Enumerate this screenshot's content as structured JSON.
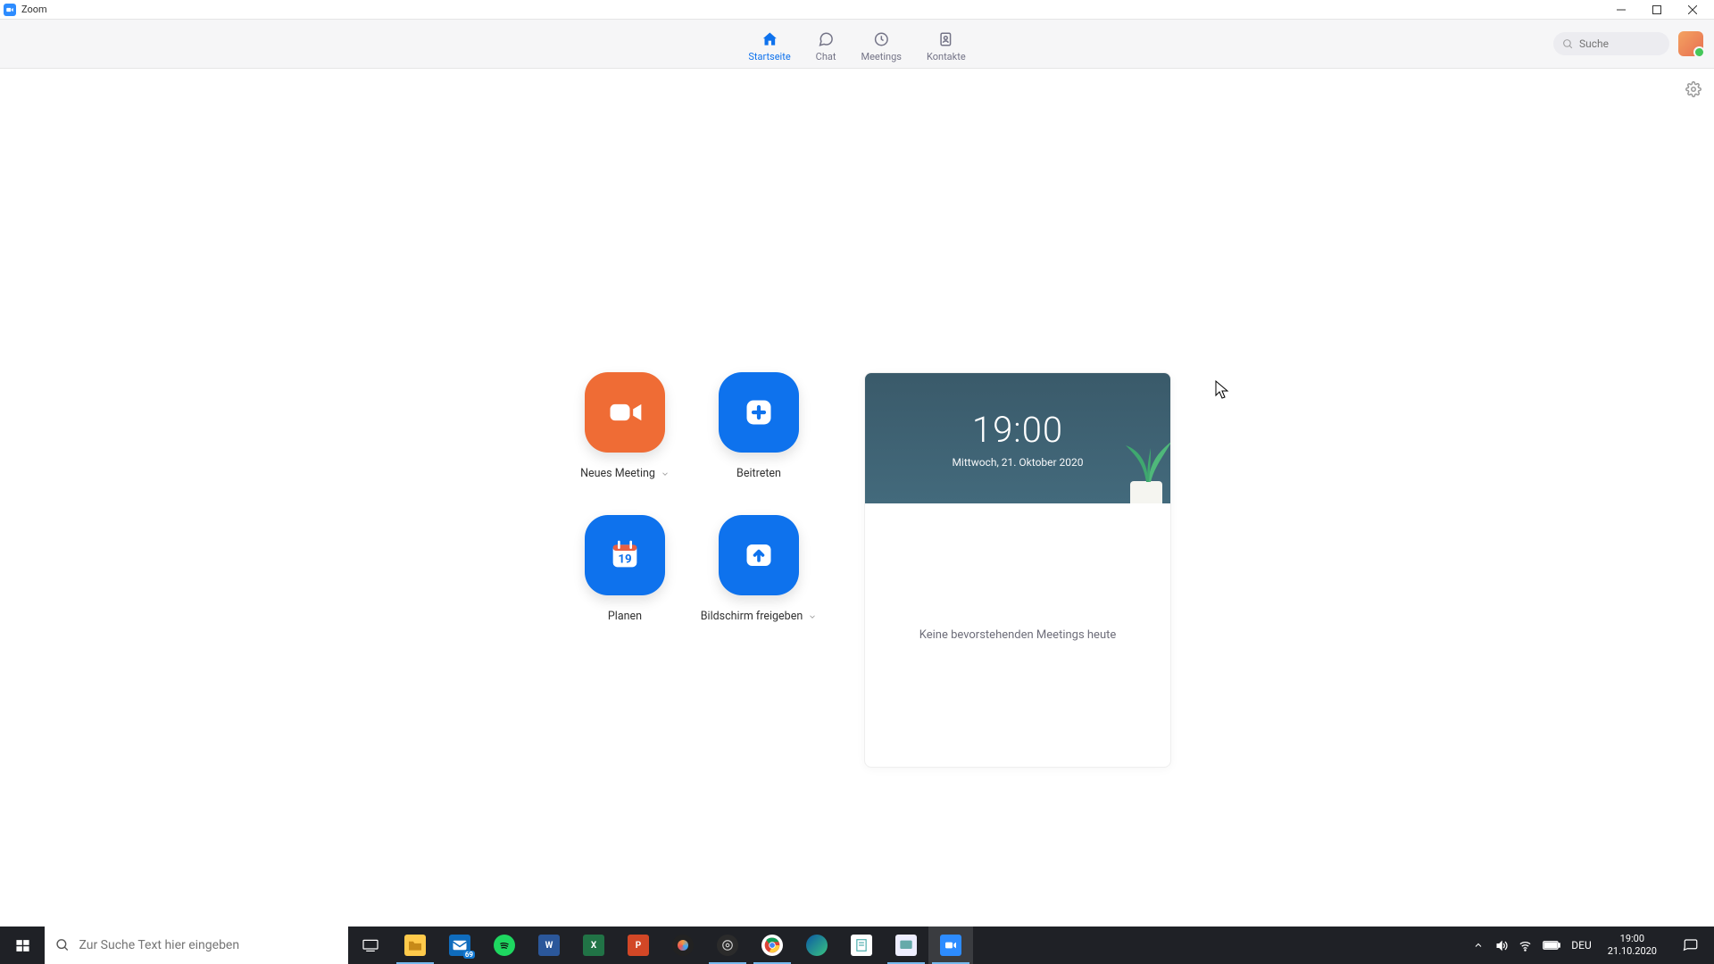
{
  "window": {
    "title": "Zoom"
  },
  "nav": {
    "home": "Startseite",
    "chat": "Chat",
    "meetings": "Meetings",
    "contacts": "Kontakte"
  },
  "search": {
    "placeholder": "Suche"
  },
  "actions": {
    "new_meeting": "Neues Meeting",
    "join": "Beitreten",
    "schedule": "Planen",
    "share_screen": "Bildschirm freigeben",
    "calendar_day": "19"
  },
  "calendar": {
    "time": "19:00",
    "date": "Mittwoch, 21. Oktober 2020",
    "empty": "Keine bevorstehenden Meetings heute"
  },
  "taskbar": {
    "search_placeholder": "Zur Suche Text hier eingeben",
    "lang": "DEU",
    "clock_time": "19:00",
    "clock_date": "21.10.2020",
    "mail_badge": "69"
  }
}
